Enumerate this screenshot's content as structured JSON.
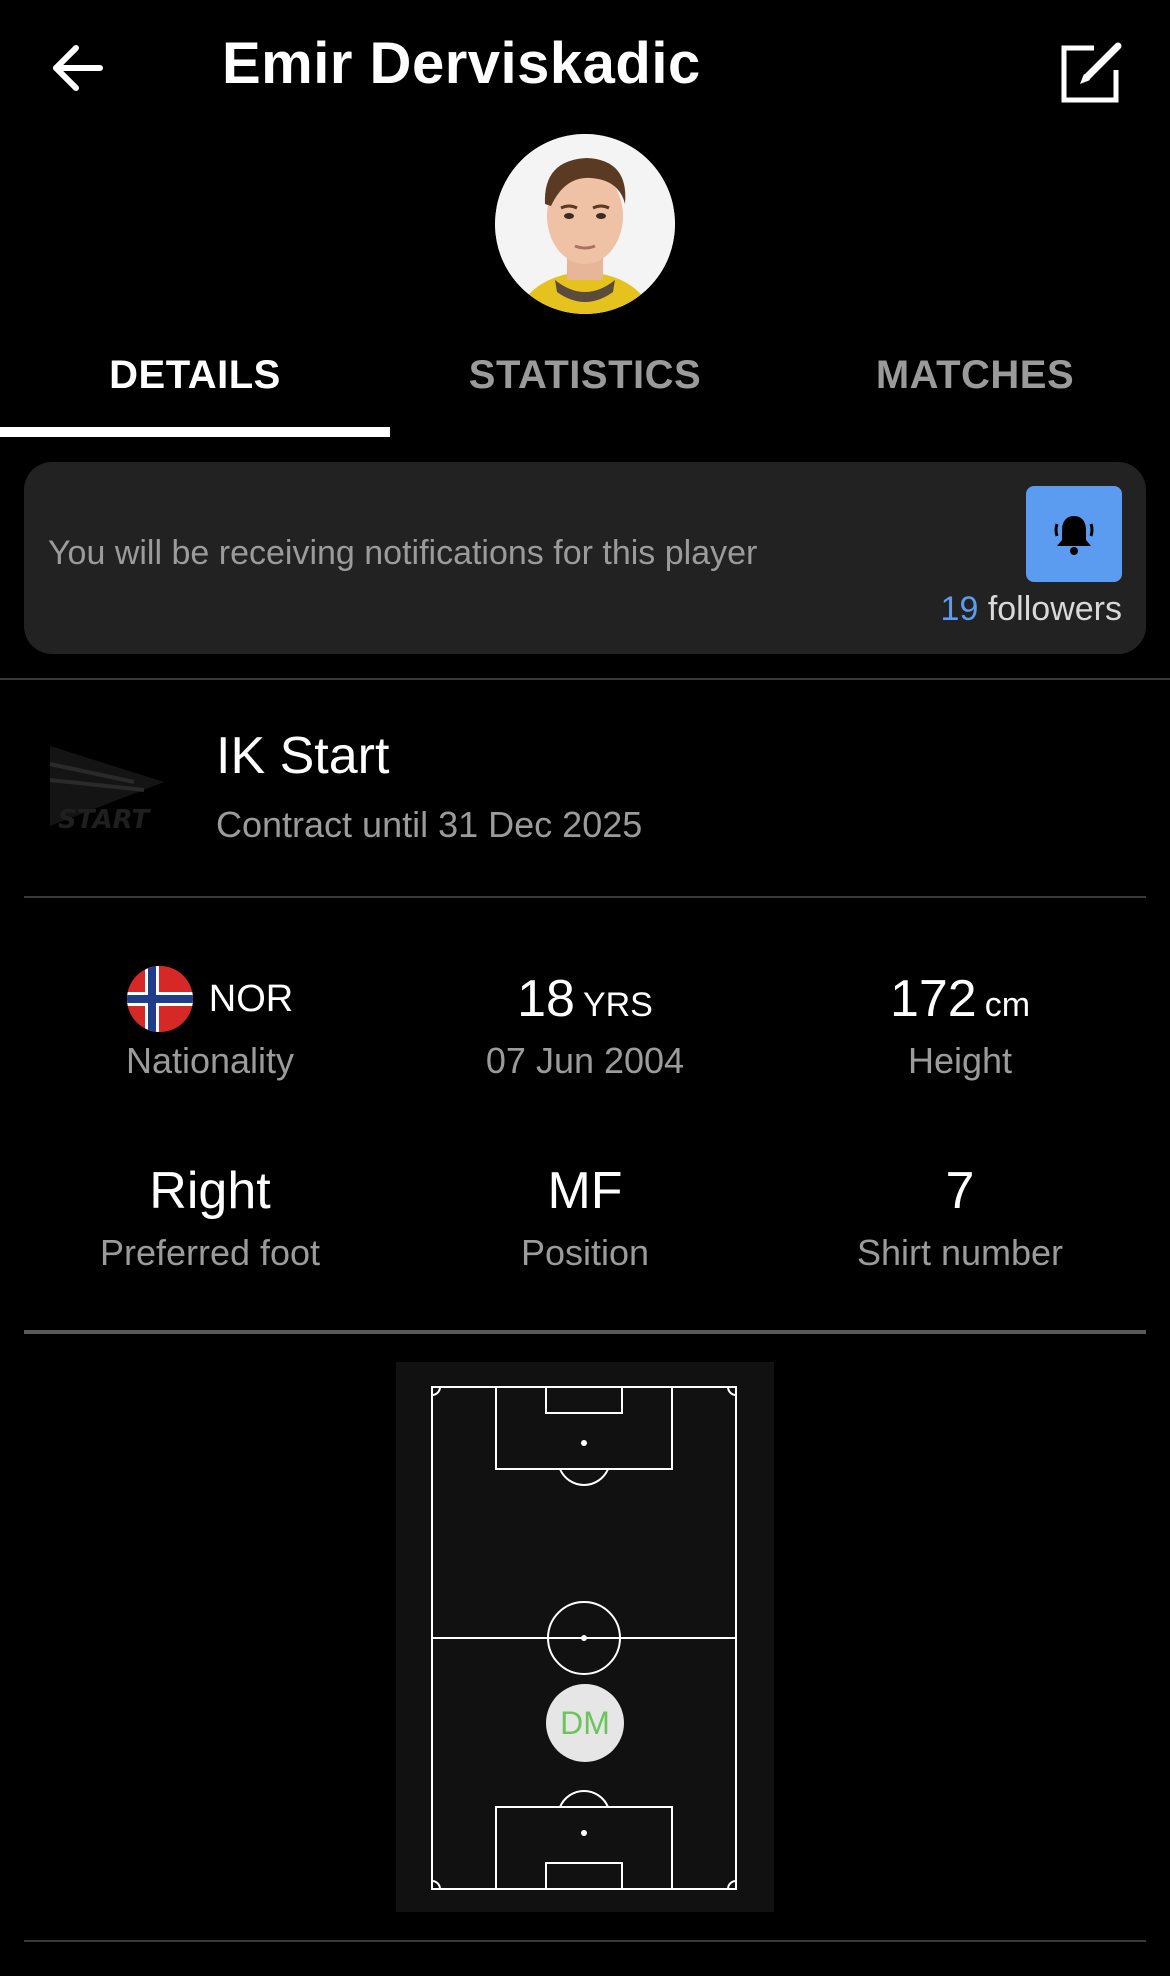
{
  "header": {
    "title": "Emir Derviskadic",
    "back_icon": "arrow-left-icon",
    "edit_icon": "edit-icon"
  },
  "tabs": [
    {
      "label": "DETAILS",
      "active": true
    },
    {
      "label": "STATISTICS",
      "active": false
    },
    {
      "label": "MATCHES",
      "active": false
    }
  ],
  "notification": {
    "text": "You will be receiving notifications for this player",
    "followers_count": "19",
    "followers_label": "followers",
    "bell_icon": "bell-icon",
    "accent_color": "#5b9bf0"
  },
  "club": {
    "name": "IK Start",
    "contract": "Contract until 31 Dec 2025"
  },
  "stats": {
    "nationality": {
      "code": "NOR",
      "label": "Nationality"
    },
    "age": {
      "value": "18",
      "unit": "YRS",
      "label": "07 Jun 2004"
    },
    "height": {
      "value": "172",
      "unit": "cm",
      "label": "Height"
    },
    "foot": {
      "value": "Right",
      "label": "Preferred foot"
    },
    "position": {
      "value": "MF",
      "label": "Position"
    },
    "shirt": {
      "value": "7",
      "label": "Shirt number"
    }
  },
  "pitch": {
    "position_badge": "DM",
    "badge_color": "#6cc55a"
  }
}
